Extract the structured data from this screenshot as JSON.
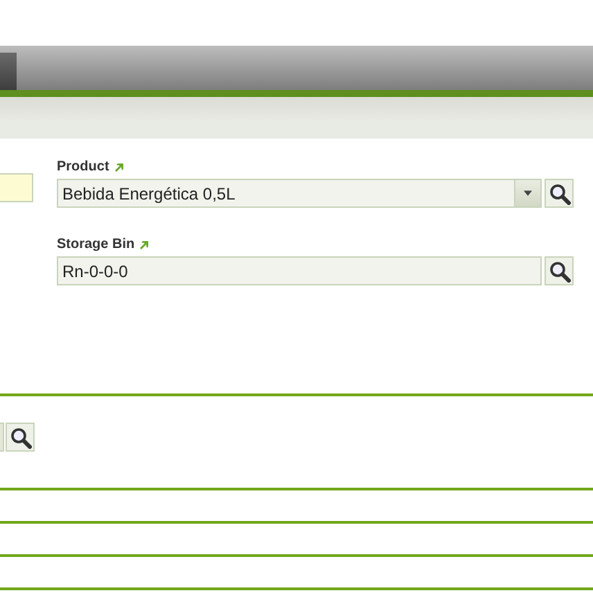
{
  "fields": [
    {
      "label": "Product",
      "value": "Bebida Energética 0,5L",
      "kind": "combo"
    },
    {
      "label": "Storage Bin",
      "value": "Rn-0-0-0",
      "kind": "search"
    }
  ]
}
